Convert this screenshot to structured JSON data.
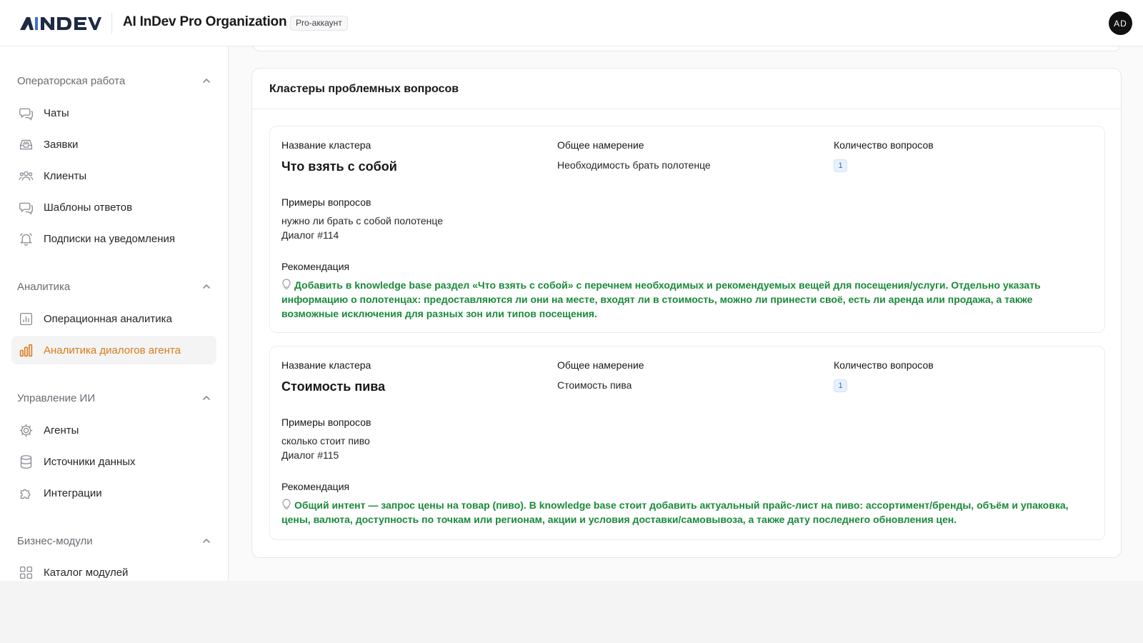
{
  "header": {
    "logo_text": "AiNDEV",
    "org_name": "AI InDev Pro Organization",
    "badge": "Pro-аккаунт",
    "avatar_initials": "AD"
  },
  "sidebar": {
    "sections": [
      {
        "title": "Операторская работа",
        "items": [
          {
            "label": "Чаты",
            "icon": "chat-icon"
          },
          {
            "label": "Заявки",
            "icon": "inbox-icon"
          },
          {
            "label": "Клиенты",
            "icon": "users-icon"
          },
          {
            "label": "Шаблоны ответов",
            "icon": "message-template-icon"
          },
          {
            "label": "Подписки на уведомления",
            "icon": "bell-icon"
          }
        ]
      },
      {
        "title": "Аналитика",
        "items": [
          {
            "label": "Операционная аналитика",
            "icon": "bar-chart-icon"
          },
          {
            "label": "Аналитика диалогов агента",
            "icon": "analytics-icon",
            "active": true
          }
        ]
      },
      {
        "title": "Управление ИИ",
        "items": [
          {
            "label": "Агенты",
            "icon": "gear-icon"
          },
          {
            "label": "Источники данных",
            "icon": "database-icon"
          },
          {
            "label": "Интеграции",
            "icon": "puzzle-icon"
          }
        ]
      },
      {
        "title": "Бизнес-модули",
        "items": [
          {
            "label": "Каталог модулей",
            "icon": "grid-icon"
          }
        ]
      }
    ]
  },
  "main": {
    "card_title": "Кластеры проблемных вопросов",
    "labels": {
      "cluster_name": "Название кластера",
      "intent": "Общее намерение",
      "count": "Количество вопросов",
      "examples": "Примеры вопросов",
      "recommendation": "Рекомендация"
    },
    "clusters": [
      {
        "name": "Что взять с собой",
        "intent": "Необходимость брать полотенце",
        "count": "1",
        "example_question": "нужно ли брать с собой полотенце",
        "example_dialog": "Диалог #114",
        "recommendation": "Добавить в knowledge base раздел «Что взять с собой» с перечнем необходимых и рекомендуемых вещей для посещения/услуги. Отдельно указать информацию о полотенцах: предоставляются ли они на месте, входят ли в стоимость, можно ли принести своё, есть ли аренда или продажа, а также возможные исключения для разных зон или типов посещения."
      },
      {
        "name": "Стоимость пива",
        "intent": "Стоимость пива",
        "count": "1",
        "example_question": "сколько стоит пиво",
        "example_dialog": "Диалог #115",
        "recommendation": "Общий интент — запрос цены на товар (пиво). В knowledge base стоит добавить актуальный прайс-лист на пиво: ассортимент/бренды, объём и упаковка, цены, валюта, доступность по точкам или регионам, акции и условия доставки/самовывоза, а также дату последнего обновления цен."
      }
    ]
  },
  "colors": {
    "accent_active": "#d97a1a",
    "recommendation_green": "#1a8a3a",
    "count_badge_blue": "#2f6fb3"
  }
}
